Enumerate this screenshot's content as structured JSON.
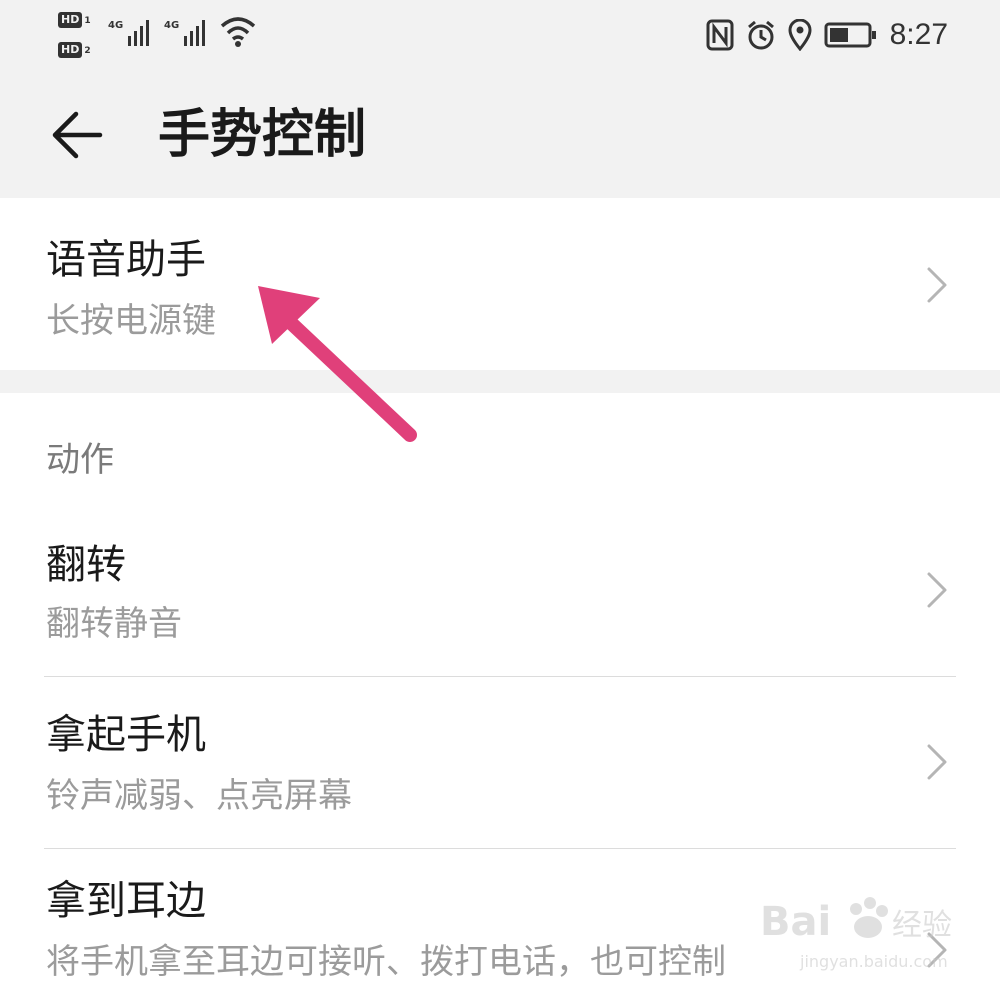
{
  "status_bar": {
    "sim1": "HD",
    "sim1_num": "1",
    "sim2": "HD",
    "sim2_num": "2",
    "net1": "4G",
    "net2": "4G",
    "time": "8:27",
    "icons": [
      "nfc-icon",
      "alarm-icon",
      "location-icon",
      "battery-icon"
    ]
  },
  "header": {
    "title": "手势控制",
    "back_icon": "back-arrow-icon"
  },
  "voice": {
    "title": "语音助手",
    "subtitle": "长按电源键"
  },
  "section_title": "动作",
  "items": [
    {
      "title": "翻转",
      "subtitle": "翻转静音"
    },
    {
      "title": "拿起手机",
      "subtitle": "铃声减弱、点亮屏幕"
    },
    {
      "title": "拿到耳边",
      "subtitle": "将手机拿至耳边可接听、拨打电话，也可控制"
    }
  ],
  "annotation": {
    "color": "#e0407a",
    "icon": "pointer-arrow"
  },
  "watermark": {
    "text": "Bai 经验",
    "sub": "jingyan.baidu.com"
  }
}
